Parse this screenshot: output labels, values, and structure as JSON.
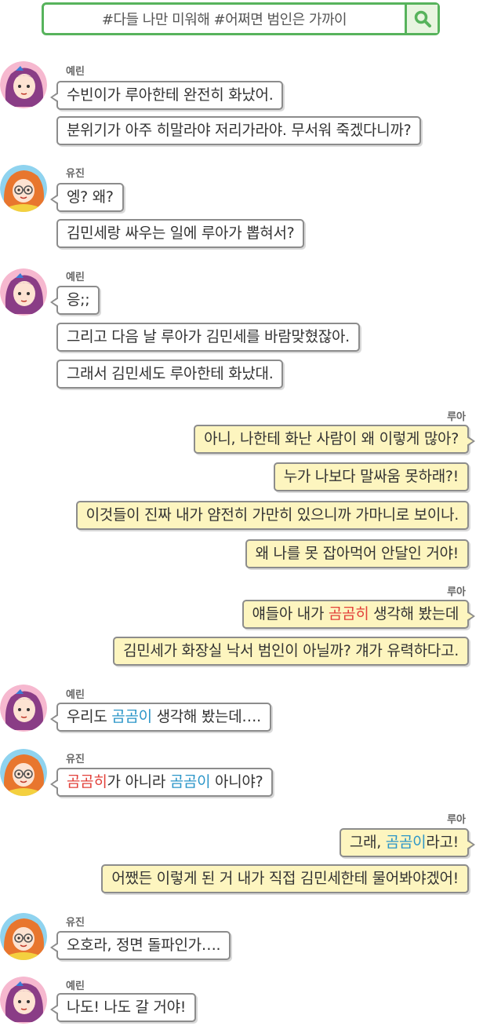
{
  "search": {
    "query": "#다들 나만 미워해  #어쩌면 범인은 가까이",
    "icon": "search-icon"
  },
  "names": {
    "yerin": "예린",
    "yujin": "유진",
    "rua": "루아"
  },
  "colors": {
    "brand_green": "#57b35c",
    "highlight_red": "#e2403a",
    "highlight_blue": "#2a95c8",
    "right_bubble": "#fdf5bf"
  },
  "messages": {
    "m1": "수빈이가 루아한테 완전히 화났어.",
    "m2": "분위기가 아주 히말라야 저리가라야. 무서워 죽겠다니까?",
    "m3": "엥? 왜?",
    "m4": "김민세랑 싸우는 일에 루아가 뽑혀서?",
    "m5": "응;;",
    "m6": "그리고 다음 날 루아가 김민세를 바람맞혔잖아.",
    "m7": "그래서 김민세도 루아한테 화났대.",
    "m8": "아니, 나한테 화난 사람이 왜 이렇게 많아?",
    "m9": "누가 나보다 말싸움 못하래?!",
    "m10": "이것들이 진짜 내가 얌전히 가만히 있으니까 가마니로 보이나.",
    "m11": "왜 나를 못 잡아먹어 안달인 거야!",
    "m12a": "얘들아 내가 ",
    "m12b": "곰곰히",
    "m12c": " 생각해 봤는데",
    "m13": "김민세가 화장실 낙서 범인이 아닐까? 걔가 유력하다고.",
    "m14a": "우리도 ",
    "m14b": "곰곰이",
    "m14c": " 생각해 봤는데….",
    "m15a": "곰곰히",
    "m15b": "가 아니라 ",
    "m15c": "곰곰이",
    "m15d": " 아니야?",
    "m16a": "그래, ",
    "m16b": "곰곰이",
    "m16c": "라고!",
    "m17": "어쨌든 이렇게 된 거 내가 직접 김민세한테 물어봐야겠어!",
    "m18": "오호라, 정면 돌파인가….",
    "m19": "나도! 나도 갈 거야!"
  }
}
